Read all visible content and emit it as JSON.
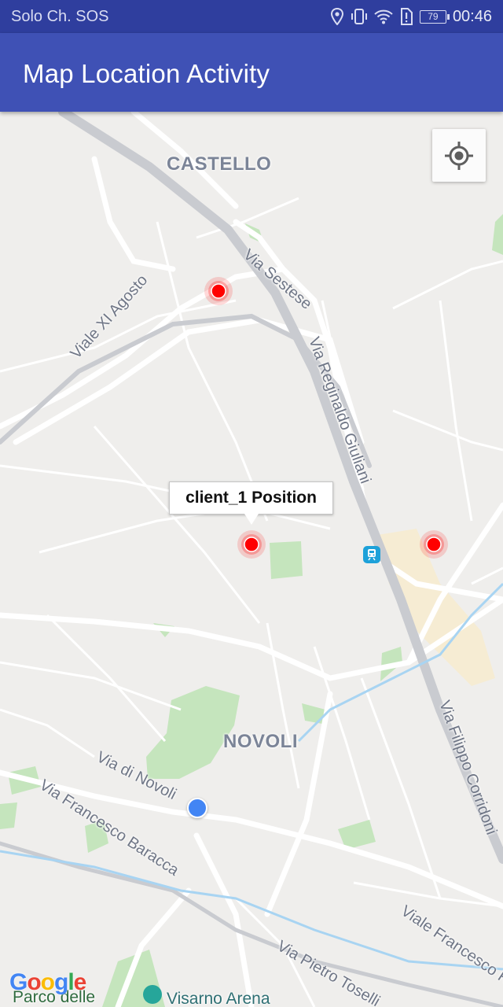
{
  "status_bar": {
    "carrier": "Solo Ch. SOS",
    "battery": "79",
    "time": "00:46",
    "icons": [
      "location-icon",
      "vibrate-icon",
      "wifi-icon",
      "alert-icon",
      "battery-icon"
    ]
  },
  "app_bar": {
    "title": "Map Location Activity",
    "color": "#3f51b5"
  },
  "map": {
    "districts": [
      "CASTELLO",
      "NOVOLI"
    ],
    "streets": [
      "Via Sestese",
      "Viale XI Agosto",
      "Via Reginaldo Giuliani",
      "Via Filippo Corridoni",
      "Via di Novoli",
      "Via Francesco Baracca",
      "Viale Francesco Redi",
      "Via Pietro Toselli"
    ],
    "pois": [
      "Parco delle",
      "Visarno Arena"
    ],
    "info_window": "client_1 Position",
    "marker_color": "#ff0000",
    "my_location_color": "#4285f4",
    "markers": [
      "marker",
      "marker",
      "marker"
    ],
    "logo": "Google"
  }
}
